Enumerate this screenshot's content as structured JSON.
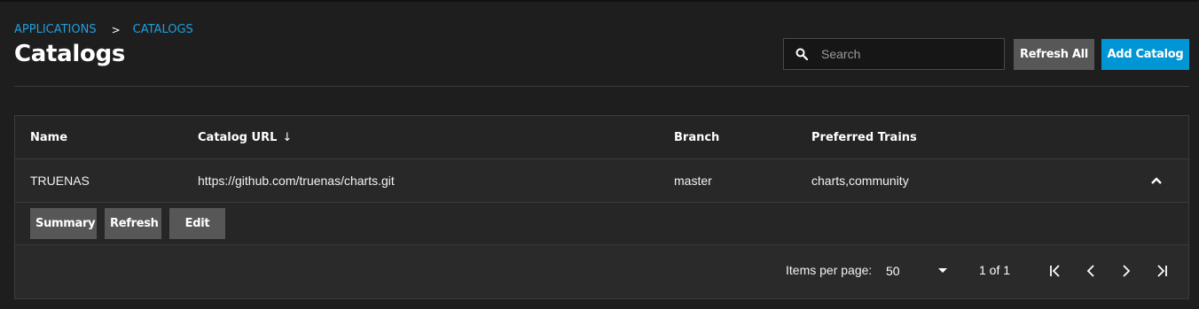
{
  "breadcrumb": {
    "items": [
      "APPLICATIONS",
      "CATALOGS"
    ],
    "separator": ">"
  },
  "page": {
    "title": "Catalogs"
  },
  "toolbar": {
    "search_placeholder": "Search",
    "refresh_all_label": "Refresh All",
    "add_catalog_label": "Add Catalog"
  },
  "table": {
    "columns": {
      "name": "Name",
      "url": "Catalog URL",
      "branch": "Branch",
      "trains": "Preferred Trains"
    },
    "sort_indicator": "↓",
    "rows": [
      {
        "name": "TRUENAS",
        "url": "https://github.com/truenas/charts.git",
        "branch": "master",
        "trains": "charts,community",
        "expanded": true
      }
    ],
    "row_actions": {
      "summary": "Summary",
      "refresh": "Refresh",
      "edit": "Edit"
    }
  },
  "paginator": {
    "items_per_page_label": "Items per page:",
    "items_per_page_value": "50",
    "range_label": "1 of 1"
  },
  "colors": {
    "accent": "#0095d5",
    "link": "#1e9fdf",
    "background": "#1e1e1e",
    "button_secondary": "#575757"
  }
}
